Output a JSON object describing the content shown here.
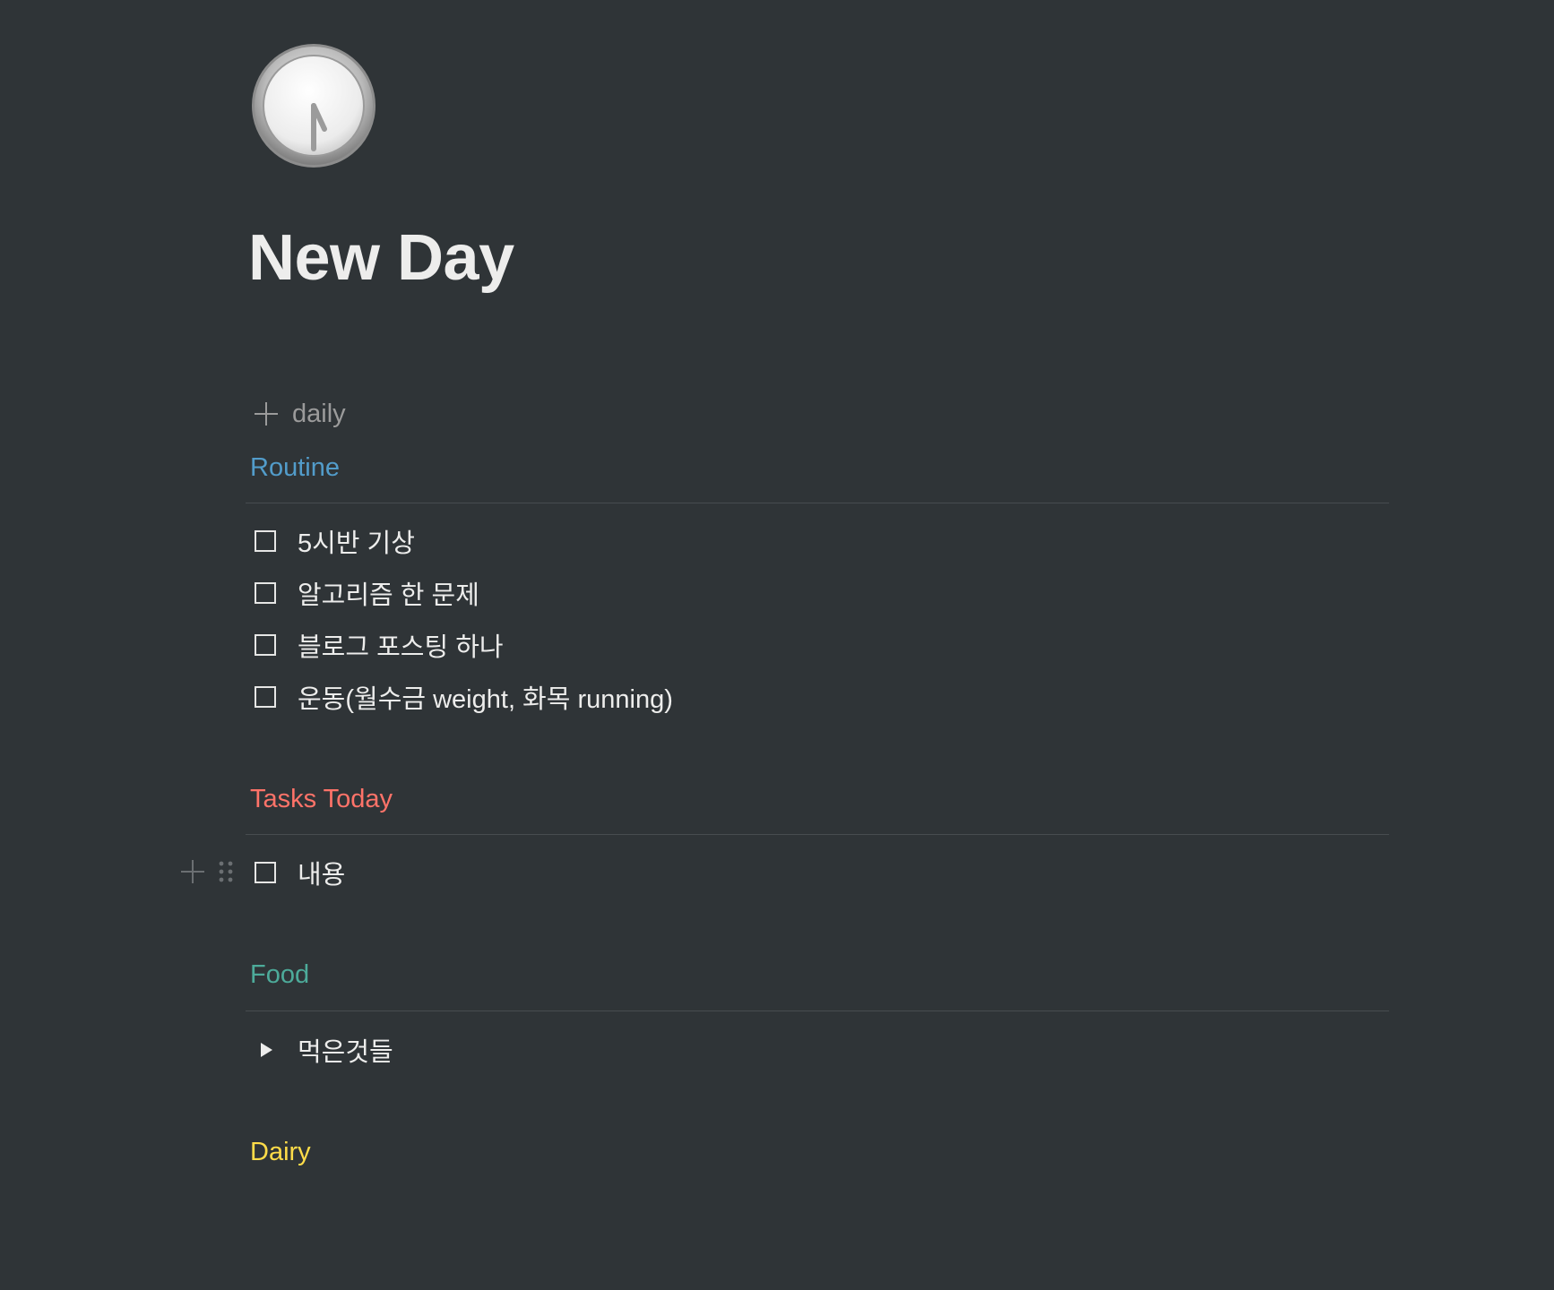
{
  "page": {
    "icon": "clock-icon",
    "title": "New Day",
    "template_button_label": "daily"
  },
  "sections": {
    "routine": {
      "heading": "Routine",
      "color": "#529cca",
      "todos": [
        "5시반 기상",
        "알고리즘 한 문제",
        "블로그 포스팅 하나",
        "운동(월수금 weight, 화목 running)"
      ]
    },
    "tasks": {
      "heading": "Tasks Today",
      "color": "#ff7369",
      "todos": [
        "내용"
      ]
    },
    "food": {
      "heading": "Food",
      "color": "#4dab9a",
      "toggle_label": "먹은것들"
    },
    "dairy": {
      "heading": "Dairy",
      "color": "#ffdc49"
    }
  },
  "colors": {
    "background": "#2f3437",
    "text": "#ededec",
    "muted": "#9b9b9b",
    "divider": "#474c50"
  }
}
